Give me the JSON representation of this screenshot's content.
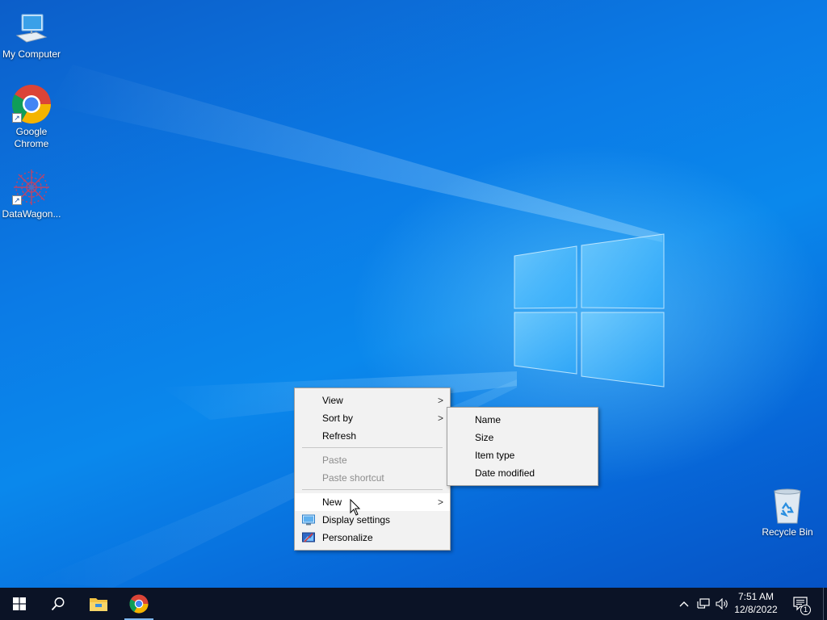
{
  "desktop": {
    "icons": [
      {
        "label": "My Computer"
      },
      {
        "label": "Google\nChrome"
      },
      {
        "label": "DataWagon..."
      },
      {
        "label": "Recycle Bin"
      }
    ]
  },
  "context_menu": {
    "items": [
      {
        "label": "View",
        "has_submenu": true
      },
      {
        "label": "Sort by",
        "has_submenu": true
      },
      {
        "label": "Refresh"
      },
      {
        "label": "Paste",
        "disabled": true
      },
      {
        "label": "Paste shortcut",
        "disabled": true
      },
      {
        "label": "New",
        "has_submenu": true,
        "hovered": true
      },
      {
        "label": "Display settings",
        "icon": "display-icon"
      },
      {
        "label": "Personalize",
        "icon": "personalize-icon"
      }
    ],
    "submenu_arrow": ">"
  },
  "sort_submenu": {
    "items": [
      {
        "label": "Name"
      },
      {
        "label": "Size"
      },
      {
        "label": "Item type"
      },
      {
        "label": "Date modified"
      }
    ]
  },
  "taskbar": {
    "pinned": [
      "start-icon",
      "search-icon",
      "file-explorer-icon",
      "chrome-icon"
    ],
    "tray_chevron": "^",
    "clock": {
      "time": "7:51 AM",
      "date": "12/8/2022"
    },
    "notification_count": "1"
  },
  "colors": {
    "taskbar_bg": "#0b1326",
    "desktop_blue": "#0a7be6",
    "menu_bg": "#f2f2f2"
  }
}
